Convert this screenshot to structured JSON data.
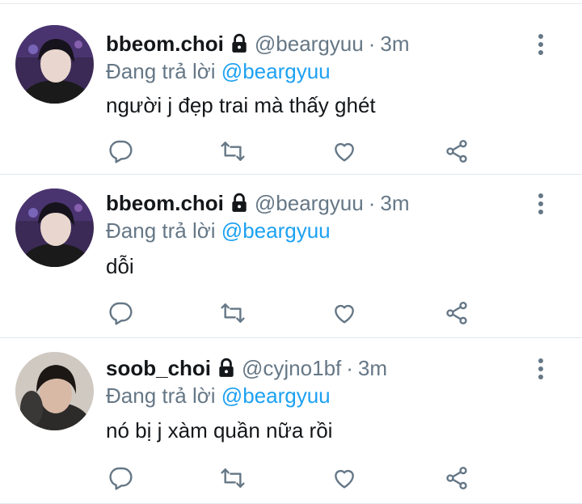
{
  "colors": {
    "link": "#1da1f2",
    "secondary": "#657786",
    "text": "#14171a",
    "divider": "#e1e8ed"
  },
  "tweets": [
    {
      "display_name": "bbeom.choi",
      "handle": "@beargyuu",
      "separator": "·",
      "time": "3m",
      "reply_prefix": "Đang trả lời",
      "reply_to": "@beargyuu",
      "text": "người j đẹp trai mà thấy ghét",
      "icons": [
        "lock-icon",
        "more-icon",
        "reply-icon",
        "retweet-icon",
        "like-icon",
        "share-icon"
      ]
    },
    {
      "display_name": "bbeom.choi",
      "handle": "@beargyuu",
      "separator": "·",
      "time": "3m",
      "reply_prefix": "Đang trả lời",
      "reply_to": "@beargyuu",
      "text": "dỗi",
      "icons": [
        "lock-icon",
        "more-icon",
        "reply-icon",
        "retweet-icon",
        "like-icon",
        "share-icon"
      ]
    },
    {
      "display_name": "soob_choi",
      "handle": "@cyjno1bf",
      "separator": "·",
      "time": "3m",
      "reply_prefix": "Đang trả lời",
      "reply_to": "@beargyuu",
      "text": "nó bị j xàm quần nữa rồi",
      "icons": [
        "lock-icon",
        "more-icon",
        "reply-icon",
        "retweet-icon",
        "like-icon",
        "share-icon"
      ]
    }
  ]
}
